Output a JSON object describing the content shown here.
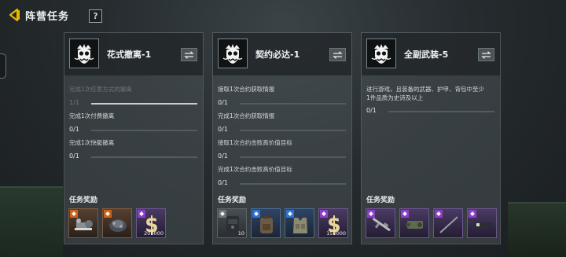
{
  "header": {
    "title": "阵营任务",
    "help_label": "?"
  },
  "cards": [
    {
      "title": "花式撤离-1",
      "tasks": [
        {
          "label": "完成1次任意方式的撤离",
          "progress": "1/1",
          "ratio": 1,
          "done": true
        },
        {
          "label": "完成1次付费撤离",
          "progress": "0/1",
          "ratio": 0,
          "done": false
        },
        {
          "label": "完成1次快艇撤离",
          "progress": "0/1",
          "ratio": 0,
          "done": false
        }
      ],
      "reward_label": "任务奖励",
      "rewards": [
        {
          "rarity": "orange",
          "icon": "gear-parts-icon",
          "qty": ""
        },
        {
          "rarity": "orange",
          "icon": "grenade-bundle-icon",
          "qty": ""
        },
        {
          "rarity": "purple",
          "icon": "currency-s-icon",
          "qty": "200000"
        }
      ]
    },
    {
      "title": "契约必达-1",
      "tasks": [
        {
          "label": "接取1次合约获取情报",
          "progress": "0/1",
          "ratio": 0,
          "done": false
        },
        {
          "label": "完成1次合约获取情报",
          "progress": "0/1",
          "ratio": 0,
          "done": false
        },
        {
          "label": "接取1次合约击败高价值目标",
          "progress": "0/1",
          "ratio": 0,
          "done": false
        },
        {
          "label": "完成1次合约击败高价值目标",
          "progress": "0/1",
          "ratio": 0,
          "done": false
        }
      ],
      "reward_label": "任务奖励",
      "rewards": [
        {
          "rarity": "gray",
          "icon": "canister-icon",
          "qty": "10"
        },
        {
          "rarity": "blue",
          "icon": "backpack-icon",
          "qty": ""
        },
        {
          "rarity": "blue",
          "icon": "vest-icon",
          "qty": ""
        },
        {
          "rarity": "purple",
          "icon": "currency-s-icon",
          "qty": "150000"
        }
      ]
    },
    {
      "title": "全副武装-5",
      "tasks": [
        {
          "label": "进行游戏，且装备的武器、护甲、背包中至少1件品质为史诗及以上",
          "progress": "0/1",
          "ratio": 0,
          "done": false
        }
      ],
      "reward_label": "任务奖励",
      "rewards": [
        {
          "rarity": "purple",
          "icon": "rifle-icon",
          "qty": ""
        },
        {
          "rarity": "purple",
          "icon": "grenade-launcher-icon",
          "qty": ""
        },
        {
          "rarity": "purple",
          "icon": "scope-rod-icon",
          "qty": ""
        },
        {
          "rarity": "purple",
          "icon": "suppressor-icon",
          "qty": ""
        }
      ]
    }
  ],
  "colors": {
    "accent": "#e6b800",
    "purple": "#8a3fc6",
    "orange": "#c8641c",
    "blue": "#2f73d1"
  }
}
